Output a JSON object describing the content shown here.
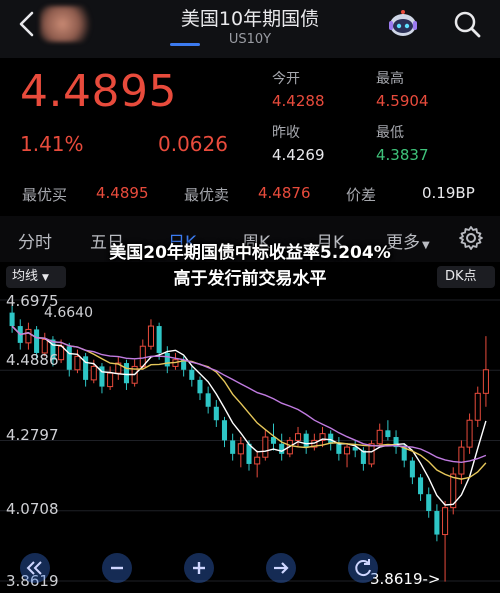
{
  "header": {
    "title": "美国10年期国债",
    "code": "US10Y"
  },
  "quote": {
    "price": "4.4895",
    "change_pct": "1.41%",
    "change": "0.0626",
    "stats": {
      "open_label": "今开",
      "open": "4.4288",
      "high_label": "最高",
      "high": "4.5904",
      "prev_close_label": "昨收",
      "prev_close": "4.4269",
      "low_label": "最低",
      "low": "4.3837"
    }
  },
  "trade": {
    "best_buy_label": "最优买",
    "best_buy": "4.4895",
    "best_sell_label": "最优卖",
    "best_sell": "4.4876",
    "spread_label": "价差",
    "spread": "0.19BP"
  },
  "tabs": [
    "分时",
    "五日",
    "日K",
    "周K",
    "月K",
    "更多"
  ],
  "active_tab": "日K",
  "chart": {
    "ma_button": "均线",
    "dk_button": "DK点",
    "y_labels": [
      "4.6975",
      "4.4886",
      "4.2797",
      "4.0708",
      "3.8619"
    ],
    "high_marker": "4.6640",
    "low_marker": "3.8619->",
    "headline_line1": "美国20年期国债中标收益率5.204%",
    "headline_line2": "高于发行前交易水平"
  },
  "colors": {
    "up": "#e84b3c",
    "down": "#2ec6c6",
    "accent": "#3c7bf0",
    "ma1": "#ffffff",
    "ma2": "#e6c75a",
    "ma3": "#c07be0"
  },
  "chart_data": {
    "type": "candlestick",
    "ylim": [
      3.8619,
      4.6975
    ],
    "candles": [
      [
        4.66,
        4.68,
        4.6,
        4.62
      ],
      [
        4.62,
        4.64,
        4.55,
        4.57
      ],
      [
        4.57,
        4.63,
        4.55,
        4.61
      ],
      [
        4.61,
        4.62,
        4.52,
        4.54
      ],
      [
        4.54,
        4.6,
        4.53,
        4.58
      ],
      [
        4.58,
        4.59,
        4.5,
        4.52
      ],
      [
        4.52,
        4.58,
        4.51,
        4.56
      ],
      [
        4.56,
        4.57,
        4.47,
        4.49
      ],
      [
        4.49,
        4.55,
        4.48,
        4.53
      ],
      [
        4.53,
        4.54,
        4.44,
        4.46
      ],
      [
        4.46,
        4.52,
        4.45,
        4.5
      ],
      [
        4.5,
        4.51,
        4.42,
        4.44
      ],
      [
        4.44,
        4.5,
        4.43,
        4.48
      ],
      [
        4.48,
        4.53,
        4.46,
        4.51
      ],
      [
        4.51,
        4.52,
        4.43,
        4.45
      ],
      [
        4.45,
        4.52,
        4.44,
        4.5
      ],
      [
        4.5,
        4.58,
        4.49,
        4.56
      ],
      [
        4.56,
        4.64,
        4.55,
        4.62
      ],
      [
        4.62,
        4.63,
        4.52,
        4.54
      ],
      [
        4.54,
        4.56,
        4.48,
        4.5
      ],
      [
        4.5,
        4.54,
        4.49,
        4.52
      ],
      [
        4.52,
        4.53,
        4.47,
        4.49
      ],
      [
        4.49,
        4.5,
        4.44,
        4.46
      ],
      [
        4.46,
        4.47,
        4.4,
        4.42
      ],
      [
        4.42,
        4.44,
        4.36,
        4.38
      ],
      [
        4.38,
        4.4,
        4.32,
        4.34
      ],
      [
        4.34,
        4.35,
        4.26,
        4.28
      ],
      [
        4.28,
        4.3,
        4.22,
        4.24
      ],
      [
        4.24,
        4.29,
        4.2,
        4.27
      ],
      [
        4.27,
        4.28,
        4.19,
        4.21
      ],
      [
        4.21,
        4.25,
        4.17,
        4.23
      ],
      [
        4.23,
        4.31,
        4.22,
        4.29
      ],
      [
        4.29,
        4.33,
        4.25,
        4.27
      ],
      [
        4.27,
        4.3,
        4.22,
        4.24
      ],
      [
        4.24,
        4.29,
        4.23,
        4.28
      ],
      [
        4.28,
        4.32,
        4.26,
        4.3
      ],
      [
        4.3,
        4.31,
        4.24,
        4.26
      ],
      [
        4.26,
        4.3,
        4.25,
        4.28
      ],
      [
        4.28,
        4.32,
        4.26,
        4.3
      ],
      [
        4.3,
        4.31,
        4.25,
        4.27
      ],
      [
        4.27,
        4.29,
        4.22,
        4.24
      ],
      [
        4.24,
        4.27,
        4.2,
        4.26
      ],
      [
        4.26,
        4.28,
        4.23,
        4.25
      ],
      [
        4.25,
        4.26,
        4.19,
        4.21
      ],
      [
        4.21,
        4.28,
        4.2,
        4.27
      ],
      [
        4.27,
        4.33,
        4.26,
        4.31
      ],
      [
        4.31,
        4.34,
        4.28,
        4.29
      ],
      [
        4.29,
        4.31,
        4.24,
        4.26
      ],
      [
        4.26,
        4.27,
        4.2,
        4.22
      ],
      [
        4.22,
        4.23,
        4.15,
        4.17
      ],
      [
        4.17,
        4.18,
        4.1,
        4.12
      ],
      [
        4.12,
        4.14,
        4.05,
        4.07
      ],
      [
        4.07,
        4.09,
        3.98,
        4.0
      ],
      [
        4.0,
        4.1,
        3.86,
        4.08
      ],
      [
        4.08,
        4.2,
        4.06,
        4.18
      ],
      [
        4.18,
        4.28,
        4.15,
        4.26
      ],
      [
        4.26,
        4.36,
        4.24,
        4.34
      ],
      [
        4.34,
        4.44,
        4.32,
        4.42
      ],
      [
        4.42,
        4.59,
        4.38,
        4.49
      ]
    ]
  }
}
